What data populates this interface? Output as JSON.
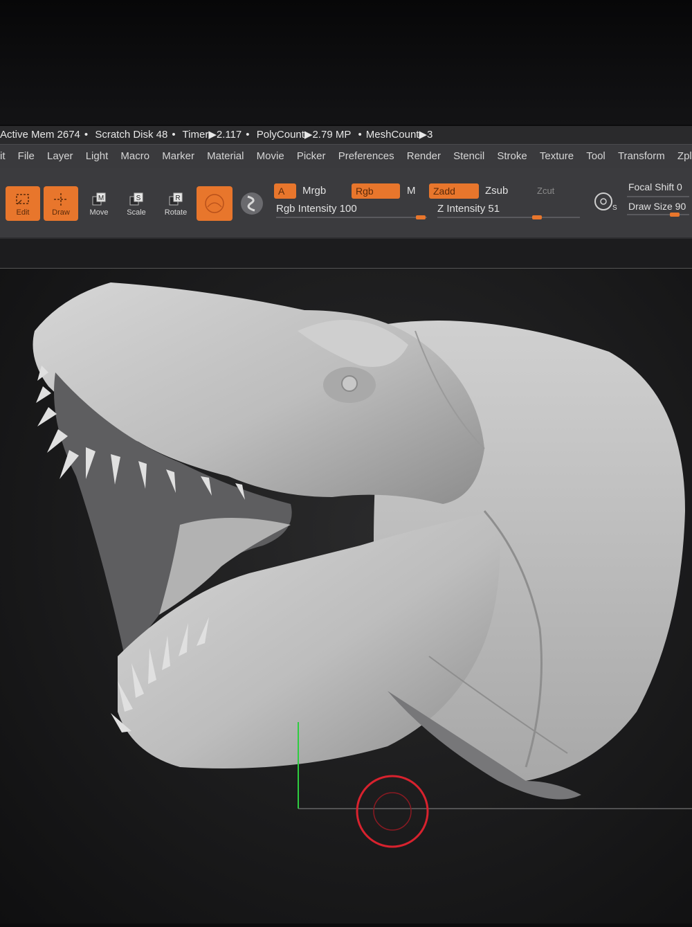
{
  "status": {
    "active_mem": "Active Mem 2674",
    "scratch_disk": "Scratch Disk 48",
    "timer": "Timer▶2.117",
    "polycount": "PolyCount▶2.79 MP",
    "meshcount": "MeshCount▶3",
    "bullet": "•"
  },
  "menu": [
    "it",
    "File",
    "Layer",
    "Light",
    "Macro",
    "Marker",
    "Material",
    "Movie",
    "Picker",
    "Preferences",
    "Render",
    "Stencil",
    "Stroke",
    "Texture",
    "Tool",
    "Transform",
    "Zplu"
  ],
  "toolbar": {
    "edit": "Edit",
    "draw": "Draw",
    "move": "Move",
    "scale": "Scale",
    "rotate": "Rotate",
    "move_key": "M",
    "scale_key": "S",
    "rotate_key": "R",
    "a": "A",
    "mrgb": "Mrgb",
    "rgb": "Rgb",
    "m": "M",
    "zadd": "Zadd",
    "zsub": "Zsub",
    "zcut": "Zcut",
    "rgb_intensity": "Rgb Intensity 100",
    "z_intensity": "Z Intensity 51",
    "focal_shift": "Focal Shift 0",
    "draw_size": "Draw Size 90",
    "s_key": "S"
  },
  "colors": {
    "accent": "#e8762c",
    "panel": "#3b3b3e",
    "axis_green": "#2ecc40",
    "cursor_red": "#d8222e"
  },
  "icons": [
    "edit-icon",
    "draw-icon",
    "move-icon",
    "scale-icon",
    "rotate-icon",
    "sphere-brush-icon",
    "material-sphere-icon",
    "lightbox-icon",
    "brush-cursor-icon",
    "dinosaur-sculpt"
  ]
}
